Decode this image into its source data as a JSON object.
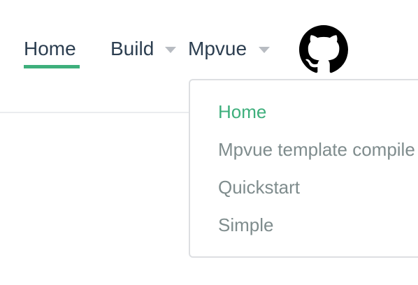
{
  "nav": {
    "items": [
      {
        "label": "Home",
        "active": true
      },
      {
        "label": "Build",
        "has_dropdown": true
      },
      {
        "label": "Mpvue",
        "has_dropdown": true,
        "expanded": true
      }
    ],
    "repo_icon": "github-icon"
  },
  "dropdown": {
    "items": [
      {
        "label": "Home",
        "active": true
      },
      {
        "label": "Mpvue template compile"
      },
      {
        "label": "Quickstart"
      },
      {
        "label": "Simple"
      }
    ]
  },
  "colors": {
    "accent": "#3eaf7c",
    "text": "#2c3e50",
    "muted": "#7f8c8d",
    "caret": "#b8bcc2"
  }
}
